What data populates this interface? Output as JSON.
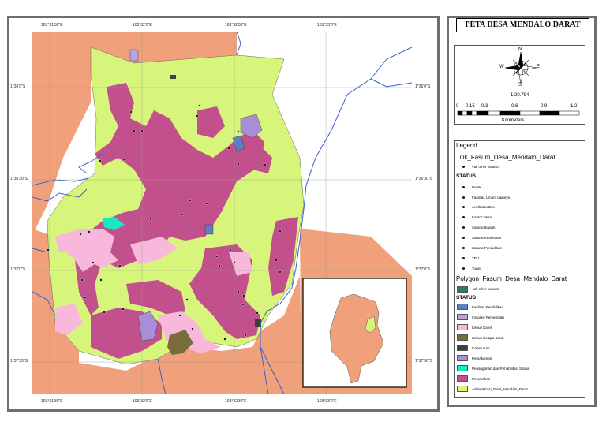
{
  "title": "PETA DESA MENDALO DARAT",
  "coords": {
    "top": [
      "103°31'30\"E",
      "103°32'0\"E",
      "103°32'30\"E",
      "103°33'0\"E"
    ],
    "bottom": [
      "103°31'30\"E",
      "103°32'0\"E",
      "103°32'30\"E",
      "103°33'0\"E"
    ],
    "left": [
      "1°36'0\"S",
      "1°36'30\"S",
      "1°37'0\"S",
      "1°37'30\"S"
    ],
    "right": [
      "1°36'0\"S",
      "1°36'30\"S",
      "1°37'0\"S",
      "1°37'30\"S"
    ]
  },
  "compass": {
    "n": "N",
    "s": "S",
    "e": "E",
    "w": "W"
  },
  "scale": {
    "ratio": "1:20.794",
    "ticks": [
      "0",
      "0.15",
      "0.3",
      "0.6",
      "0.9",
      "1.2"
    ],
    "units": "Kilometers"
  },
  "legend": {
    "heading": "Legend",
    "points_layer": "Titik_Fasum_Desa_Mendalo_Darat",
    "points_other": "<all other values>",
    "points_status": "STATUS",
    "points": [
      "BANK",
      "Fasilitas Umum Lainnya",
      "Jembatan/Box",
      "Kantor Desa",
      "Sarana Ibadah",
      "Sarana Kesehatan",
      "Sarana Pendidikan",
      "TPU",
      "Tower"
    ],
    "poly_layer": "Polygon_Fasum_Desa_Mendalo_Darat",
    "poly_other": "<all other values>",
    "poly_status": "STATUS",
    "polys": [
      {
        "label": "Fasilitas Pendidikan",
        "color": "#5b7fc4"
      },
      {
        "label": "Instalasi Pemerintah",
        "color": "#b9a3d9"
      },
      {
        "label": "Kebun Karet",
        "color": "#f7b8dc"
      },
      {
        "label": "Kebun Kelapa Sawit",
        "color": "#7a6b3a"
      },
      {
        "label": "Kolam Ikan",
        "color": "#3f3f3f"
      },
      {
        "label": "Pemakaman",
        "color": "#a88ed6"
      },
      {
        "label": "Penanganan dan Rehabilitasi Satwa",
        "color": "#19e8c4"
      },
      {
        "label": "Perumahan",
        "color": "#c2508c"
      },
      {
        "label": "Administrasi_Desa_Mendalo_Darat",
        "color": "#d6f57a"
      }
    ]
  },
  "colors": {
    "outside": "#f0a07a",
    "desa": "#d6f57a",
    "perumahan": "#c2508c",
    "karet": "#f7b8dc",
    "river": "#3a5fd0",
    "other_swatch": "#2e7d5b"
  }
}
